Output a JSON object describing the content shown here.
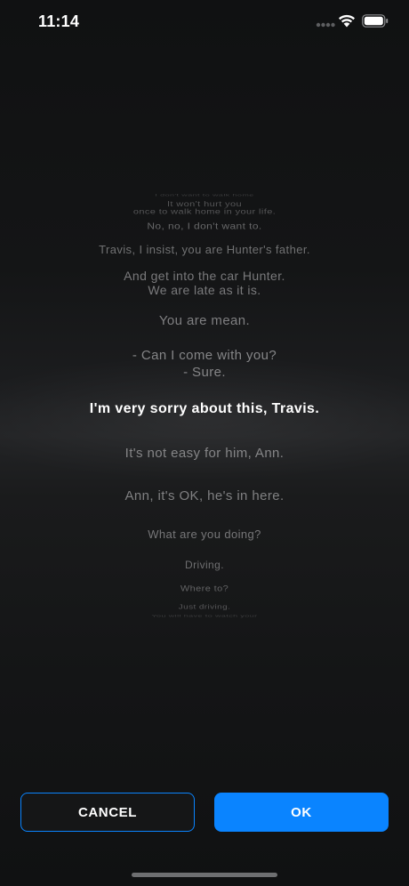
{
  "status_bar": {
    "time": "11:14"
  },
  "subtitles": {
    "lines": [
      "I don't want to walk home",
      "It won't hurt you\nonce to walk home in your life.",
      "No, no, I don't want to.",
      "Travis, I insist, you are Hunter's father.",
      "And get into the car Hunter.\nWe are late as it is.",
      "You are mean.",
      "- Can I come with you?\n- Sure.",
      "I'm very sorry about this, Travis.",
      "It's not easy for him, Ann.",
      "Ann, it's OK, he's in here.",
      "What are you doing?",
      "Driving.",
      "Where to?",
      "Just driving.",
      "You will have to watch your"
    ],
    "selected": "I'm very sorry about this, Travis."
  },
  "buttons": {
    "cancel": "CANCEL",
    "ok": "OK"
  },
  "colors": {
    "accent": "#0a84ff",
    "background": "#161718",
    "text_selected": "#ffffff",
    "text_dim": "#8b8b8d"
  },
  "icons": {
    "signal": "signal-dots-icon",
    "wifi": "wifi-icon",
    "battery": "battery-icon"
  }
}
